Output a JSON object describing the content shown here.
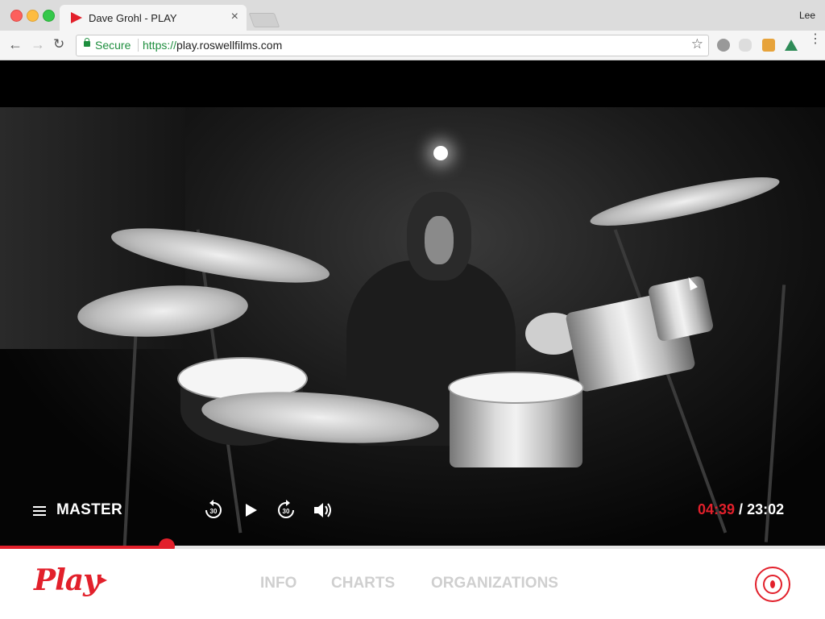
{
  "browser": {
    "tab_title": "Dave Grohl - PLAY",
    "tab_close": "×",
    "profile_name": "Lee",
    "secure_label": "Secure",
    "url_scheme": "https://",
    "url_host": "play.roswellfilms.com",
    "star_glyph": "☆",
    "back_glyph": "←",
    "forward_glyph": "→",
    "reload_glyph": "↻",
    "menu_glyph": "⋮"
  },
  "player": {
    "track_label": "MASTER",
    "current_time": "04:39",
    "separator": " / ",
    "total_time": "23:02",
    "progress_fraction": 0.202
  },
  "nav": {
    "logo_text": "Play",
    "items": [
      {
        "label": "INFO"
      },
      {
        "label": "CHARTS"
      },
      {
        "label": "ORGANIZATIONS"
      }
    ]
  },
  "colors": {
    "accent": "#e2202b",
    "nav_inactive": "#cfcfcf",
    "secure_green": "#1e8e3e"
  },
  "icons": {
    "rewind": "rewind-30-icon",
    "play": "play-icon",
    "forward": "forward-30-icon",
    "volume": "volume-icon",
    "menu": "hamburger-icon"
  }
}
